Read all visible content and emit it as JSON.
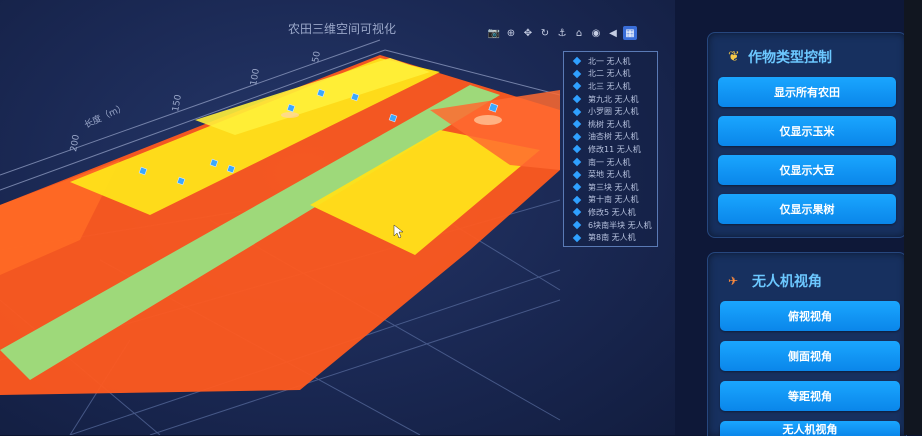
{
  "scene": {
    "title": "农田三维空间可视化",
    "axis_label": "长度（m）",
    "ticks": [
      "50",
      "100",
      "150",
      "200"
    ],
    "colors": {
      "orange": "#ff5a1f",
      "yellow": "#ffe11a",
      "green": "#8ef08a",
      "grid": "#5a6ea0"
    }
  },
  "toolbar": {
    "icons": [
      "camera-icon",
      "zoom-icon",
      "pan-icon",
      "rotate-icon",
      "anchor-icon",
      "home-icon",
      "camera-alt-icon",
      "tag-icon",
      "chart-icon"
    ]
  },
  "legend": {
    "items": [
      "北一 无人机",
      "北二 无人机",
      "北三 无人机",
      "第九北 无人机",
      "小罗圈 无人机",
      "桃树 无人机",
      "油杏树 无人机",
      "修改11 无人机",
      "南一 无人机",
      "菜地 无人机",
      "第三块 无人机",
      "第十南 无人机",
      "修改5 无人机",
      "6块南半块 无人机",
      "第8南 无人机"
    ]
  },
  "crop_panel": {
    "title": "作物类型控制",
    "buttons": [
      "显示所有农田",
      "仅显示玉米",
      "仅显示大豆",
      "仅显示果树"
    ]
  },
  "drone_panel": {
    "title": "无人机视角",
    "buttons": [
      "俯视视角",
      "侧面视角",
      "等距视角",
      "无人机视角"
    ]
  }
}
